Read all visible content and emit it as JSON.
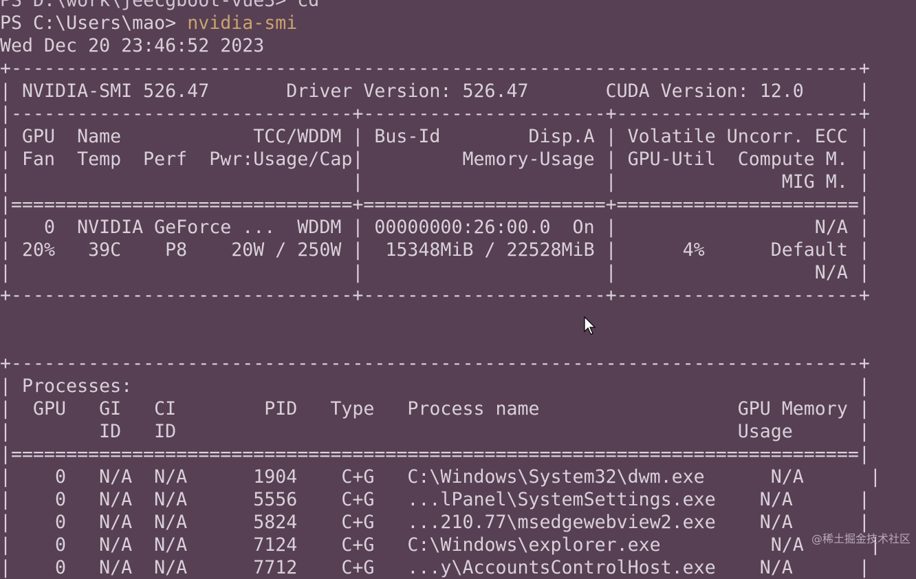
{
  "terminal": {
    "prev_line": "PS D:\\work\\jeecgboot-vue3> cd",
    "prompt": "PS C:\\Users\\mao> ",
    "command": "nvidia-smi",
    "timestamp": "Wed Dec 20 23:46:52 2023",
    "lines": [
      "+-----------------------------------------------------------------------------+",
      "| NVIDIA-SMI 526.47       Driver Version: 526.47       CUDA Version: 12.0     |",
      "|-------------------------------+----------------------+----------------------+",
      "| GPU  Name            TCC/WDDM | Bus-Id        Disp.A | Volatile Uncorr. ECC |",
      "| Fan  Temp  Perf  Pwr:Usage/Cap|         Memory-Usage | GPU-Util  Compute M. |",
      "|                               |                      |               MIG M. |",
      "|===============================+======================+======================|",
      "|   0  NVIDIA GeForce ...  WDDM | 00000000:26:00.0  On |                  N/A |",
      "| 20%   39C    P8    20W / 250W |  15348MiB / 22528MiB |      4%      Default |",
      "|                               |                      |                  N/A |",
      "+-------------------------------+----------------------+----------------------+",
      "",
      "",
      "+-----------------------------------------------------------------------------+",
      "| Processes:                                                                  |",
      "|  GPU   GI   CI        PID   Type   Process name                  GPU Memory |",
      "|        ID   ID                                                   Usage      |",
      "|=============================================================================|",
      "|    0   N/A  N/A      1904    C+G   C:\\Windows\\System32\\dwm.exe      N/A      |",
      "|    0   N/A  N/A      5556    C+G   ...lPanel\\SystemSettings.exe    N/A      |",
      "|    0   N/A  N/A      5824    C+G   ...210.77\\msedgewebview2.exe    N/A      |",
      "|    0   N/A  N/A      7124    C+G   C:\\Windows\\explorer.exe          N/A      |",
      "|    0   N/A  N/A      7712    C+G   ...y\\AccountsControlHost.exe    N/A      |"
    ]
  },
  "watermark": "@稀土掘金技术社区"
}
